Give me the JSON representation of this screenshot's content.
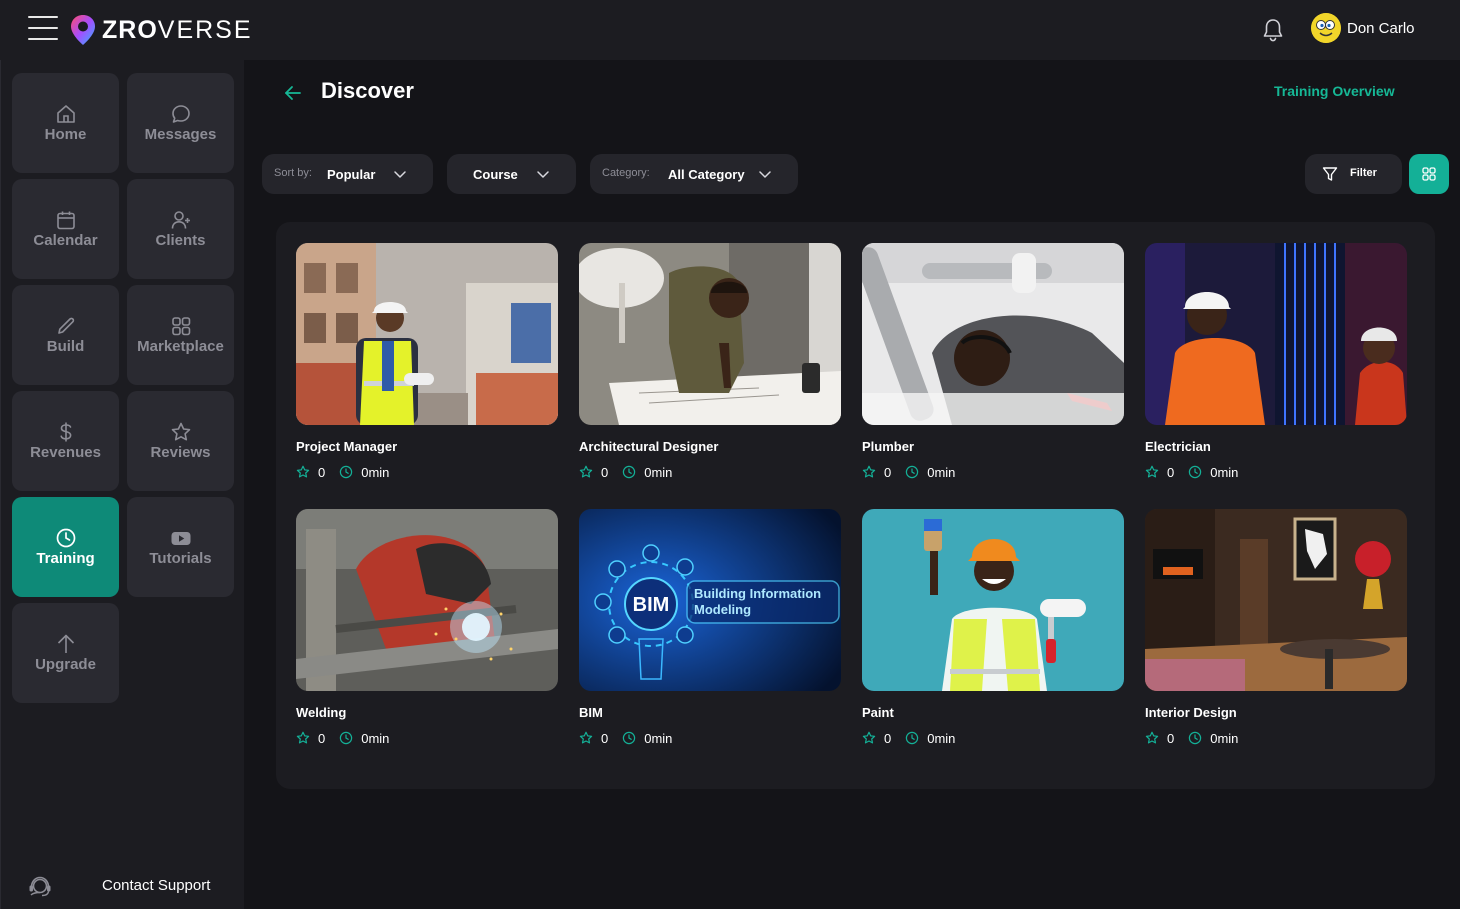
{
  "app": {
    "logo_bold": "ZRO",
    "logo_thin": "VERSE",
    "accent": "#14b097",
    "accent_dark": "#0e8a78"
  },
  "header": {
    "user_name": "Don Carlo"
  },
  "sidebar": {
    "items": [
      {
        "label": "Home",
        "icon": "home-icon"
      },
      {
        "label": "Messages",
        "icon": "chat-bubble-icon"
      },
      {
        "label": "Calendar",
        "icon": "calendar-icon"
      },
      {
        "label": "Clients",
        "icon": "user-plus-icon"
      },
      {
        "label": "Build",
        "icon": "pencil-icon"
      },
      {
        "label": "Marketplace",
        "icon": "grid-icon"
      },
      {
        "label": "Revenues",
        "icon": "dollar-icon"
      },
      {
        "label": "Reviews",
        "icon": "star-icon"
      },
      {
        "label": "Training",
        "icon": "clock-icon",
        "active": true
      },
      {
        "label": "Tutorials",
        "icon": "youtube-icon"
      },
      {
        "label": "Upgrade",
        "icon": "arrow-up-icon"
      }
    ],
    "support_label": "Contact Support"
  },
  "page": {
    "title": "Discover",
    "overview_link": "Training Overview"
  },
  "filters": {
    "sort_label": "Sort by:",
    "sort_value": "Popular",
    "type_value": "Course",
    "category_label": "Category:",
    "category_value": "All Category",
    "filter_label": "Filter"
  },
  "courses": [
    {
      "title": "Project Manager",
      "rating": "0",
      "duration": "0min"
    },
    {
      "title": "Architectural Designer",
      "rating": "0",
      "duration": "0min"
    },
    {
      "title": "Plumber",
      "rating": "0",
      "duration": "0min"
    },
    {
      "title": "Electrician",
      "rating": "0",
      "duration": "0min"
    },
    {
      "title": "Welding",
      "rating": "0",
      "duration": "0min"
    },
    {
      "title": "BIM",
      "rating": "0",
      "duration": "0min",
      "image_text": [
        "BIM",
        "Building Information",
        "Modeling"
      ]
    },
    {
      "title": "Paint",
      "rating": "0",
      "duration": "0min"
    },
    {
      "title": "Interior Design",
      "rating": "0",
      "duration": "0min"
    }
  ]
}
